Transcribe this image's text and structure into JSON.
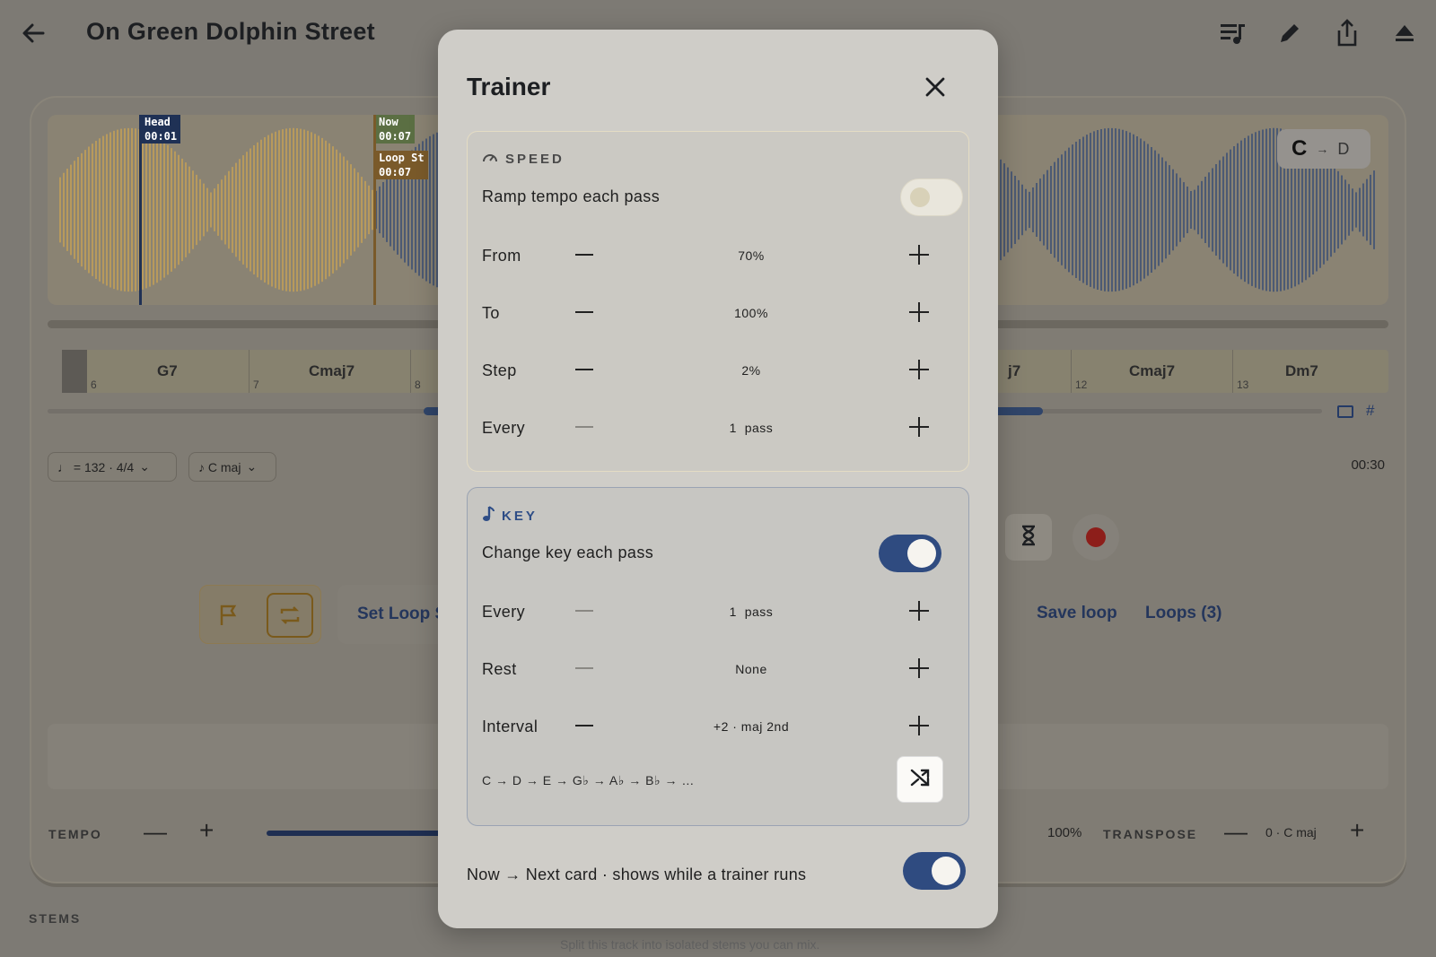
{
  "header": {
    "title": "On Green Dolphin Street"
  },
  "icons": {
    "back": "arrow-left-icon",
    "top": [
      "queue-music-icon",
      "pencil-icon",
      "share-icon",
      "eject-icon"
    ]
  },
  "waveform": {
    "markers": [
      {
        "label": "Head",
        "time": "00:01"
      },
      {
        "label": "Now",
        "time": "00:07"
      },
      {
        "label": "Loop St",
        "time": "00:07"
      }
    ],
    "key_chip": {
      "from": "C",
      "to": "D"
    },
    "colors": {
      "played": "#b89a5c",
      "unplayed": "#4c5a74"
    }
  },
  "chords": [
    {
      "name": "G7",
      "bar": "6"
    },
    {
      "name": "Cmaj7",
      "bar": "7"
    },
    {
      "name": "",
      "bar": "8"
    },
    {
      "name": "j7",
      "bar": ""
    },
    {
      "name": "Cmaj7",
      "bar": "12"
    },
    {
      "name": "Dm7",
      "bar": "13"
    }
  ],
  "controls": {
    "tempo_pill": "♩ = 132 · 4/4",
    "key_pill": "♪ C maj",
    "time_right": "00:30",
    "set_loop": "Set Loop S",
    "save_loop": "Save loop",
    "loops": "Loops (3)",
    "tempo_label": "TEMPO",
    "tempo_value": "100%",
    "transpose_label": "TRANSPOSE",
    "transpose_value": "0 · C maj",
    "stems_label": "STEMS",
    "stems_sub": "Split this track into isolated stems you can mix."
  },
  "trainer": {
    "title": "Trainer",
    "speed": {
      "heading": "SPEED",
      "ramp_label": "Ramp tempo each pass",
      "ramp_on": false,
      "rows": [
        {
          "label": "From",
          "value": "70%"
        },
        {
          "label": "To",
          "value": "100%"
        },
        {
          "label": "Step",
          "value": "2%"
        },
        {
          "label": "Every",
          "value": "1  pass"
        }
      ]
    },
    "key": {
      "heading": "KEY",
      "change_label": "Change key each pass",
      "change_on": true,
      "rows": [
        {
          "label": "Every",
          "value": "1  pass"
        },
        {
          "label": "Rest",
          "value": "None"
        },
        {
          "label": "Interval",
          "value": "+2 · maj 2nd"
        }
      ],
      "sequence": "C → D → E → G♭ → A♭ → B♭ → …"
    },
    "footer_label": "Now → Next card · shows while a trainer runs",
    "footer_on": true,
    "accent": "#2f4b80"
  }
}
